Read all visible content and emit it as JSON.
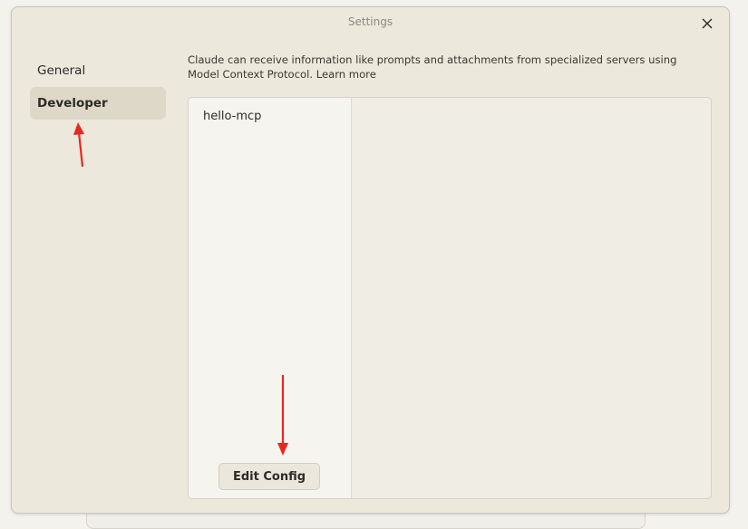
{
  "window": {
    "title": "Settings",
    "close_icon": "close-icon"
  },
  "sidebar": {
    "items": [
      {
        "label": "General",
        "selected": false
      },
      {
        "label": "Developer",
        "selected": true
      }
    ]
  },
  "main": {
    "description": "Claude can receive information like prompts and attachments from specialized servers using Model Context Protocol.",
    "learn_more": "Learn more",
    "servers": [
      {
        "name": "hello-mcp"
      }
    ],
    "edit_config_label": "Edit Config"
  },
  "annotations": {
    "arrow_color": "#e8281f",
    "arrow_icon": "red-arrow-icon"
  },
  "colors": {
    "window_bg": "#ece8dc",
    "selected_item_bg": "#ddd8c7",
    "panel_bg": "#f0ede4"
  }
}
